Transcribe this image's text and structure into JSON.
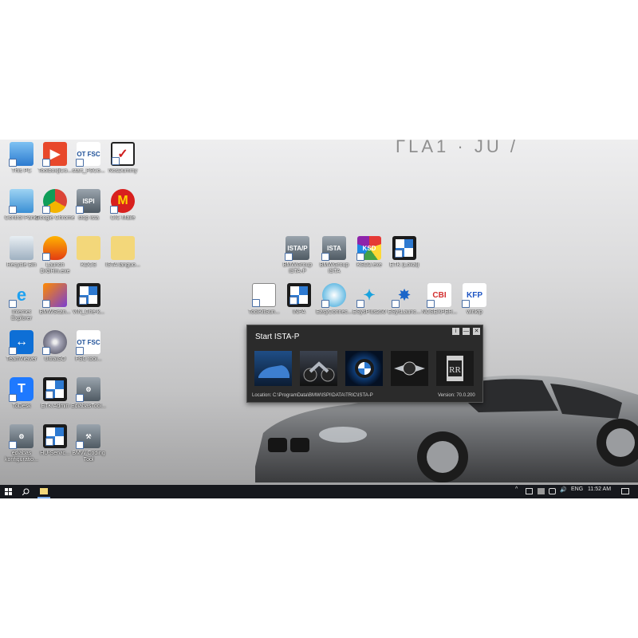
{
  "wallpaper": {
    "text": "ΓLA1 · JU /"
  },
  "desktop_icons": [
    {
      "id": "this-pc",
      "label": "This PC",
      "icon": "computer-icon"
    },
    {
      "id": "toolbox",
      "label": "Toolbox[iCo...",
      "icon": "play-icon"
    },
    {
      "id": "start-fsc",
      "label": "start_FSCo...",
      "icon": "otfsc-icon"
    },
    {
      "id": "ncs-dummy",
      "label": "NcsDummy",
      "icon": "checkmark-icon"
    },
    {
      "id": "control-panel",
      "label": "Control Panel",
      "icon": "control-panel-icon"
    },
    {
      "id": "chrome",
      "label": "Google Chrome",
      "icon": "chrome-icon"
    },
    {
      "id": "stop-ista",
      "label": "stop ista",
      "icon": "ispi-icon"
    },
    {
      "id": "cic-mails",
      "label": "CIC Maile",
      "icon": "m-logo-icon"
    },
    {
      "id": "recycle-bin",
      "label": "Recycle Bin",
      "icon": "recycle-bin-icon"
    },
    {
      "id": "launch-dr",
      "label": "Launch DrGHm.exe",
      "icon": "flame-icon"
    },
    {
      "id": "kdcs",
      "label": "KDCS",
      "icon": "folder-icon"
    },
    {
      "id": "ista-languages",
      "label": "ISTA languo...",
      "icon": "folder-icon"
    },
    {
      "id": "ie",
      "label": "Internet Explorer",
      "icon": "internet-explorer-icon"
    },
    {
      "id": "bmw-scan",
      "label": "BMWScan...",
      "icon": "bmw-scanner-icon"
    },
    {
      "id": "vin-check",
      "label": "VIN_Che-k...",
      "icon": "bmw-logo-icon"
    },
    {
      "id": "teamviewer",
      "label": "TeamViewer",
      "icon": "teamviewer-icon"
    },
    {
      "id": "ultraiso",
      "label": "UltraISO",
      "icon": "disc-icon"
    },
    {
      "id": "fsc-tools",
      "label": "FSC tool...",
      "icon": "otfsc-icon"
    },
    {
      "id": "todesk",
      "label": "ToDesk",
      "icon": "todesk-icon"
    },
    {
      "id": "etk-admin",
      "label": "ETK Admin",
      "icon": "bmw-logo-icon"
    },
    {
      "id": "ediabas-tool",
      "label": "EdiabasTool...",
      "icon": "ediabas-icon"
    },
    {
      "id": "ediabas-config",
      "label": "ediabas konfiguratio...",
      "icon": "ediabas-icon"
    },
    {
      "id": "hu-service",
      "label": "HU-Servic...",
      "icon": "bmw-logo-icon"
    },
    {
      "id": "bmw-coding-tool",
      "label": "BMW Coding Tool",
      "icon": "coding-tool-icon"
    },
    {
      "id": "ista-p",
      "label": "BMWGroup ISTA-P",
      "icon": "ista-p-icon"
    },
    {
      "id": "ista",
      "label": "BMWGroup ISTA",
      "icon": "ista-icon"
    },
    {
      "id": "ksd",
      "label": "KSD2.exe",
      "icon": "ksd-icon"
    },
    {
      "id": "etk-local",
      "label": "ETK (Lokal)",
      "icon": "bmw-logo-icon"
    },
    {
      "id": "toolkitsun",
      "label": "ToolKitSun...",
      "icon": "toolkit-icon"
    },
    {
      "id": "inpa",
      "label": "INPA",
      "icon": "bmw-logo-icon"
    },
    {
      "id": "easyconnect",
      "label": "EasyConnec...",
      "icon": "easyconnect-icon"
    },
    {
      "id": "esys-plus",
      "label": "ESysPlus250",
      "icon": "esys-icon"
    },
    {
      "id": "esys-launcher",
      "label": "ESysLaunc...",
      "icon": "esys-launcher-icon"
    },
    {
      "id": "ncs-expert",
      "label": "NCSEXPER...",
      "icon": "cbi-icon"
    },
    {
      "id": "winkfp",
      "label": "winkfp",
      "icon": "kfp-icon"
    }
  ],
  "ista_window": {
    "title": "Start ISTA-P",
    "buttons": {
      "info": "i",
      "minimize": "—",
      "close": "✕"
    },
    "thumbnails": [
      {
        "id": "car",
        "name": "bmw-car-thumbnail"
      },
      {
        "id": "motorrad",
        "name": "bmw-motorcycle-thumbnail"
      },
      {
        "id": "bmw",
        "name": "bmw-logo-thumbnail"
      },
      {
        "id": "mini",
        "name": "mini-logo-thumbnail"
      },
      {
        "id": "rolls",
        "name": "rolls-royce-logo-thumbnail"
      }
    ],
    "location": "Location:  C:\\ProgramData\\BMW\\ISPI\\DATA\\TRIC\\ISTA-P",
    "version": "Version:  70.0.200"
  },
  "taskbar": {
    "language": "ENG",
    "time": "11:52 AM",
    "tray_chevron": "^",
    "speaker": "🔊"
  }
}
